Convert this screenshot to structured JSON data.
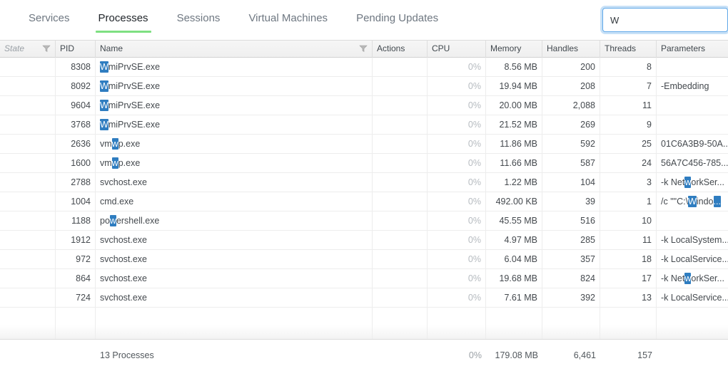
{
  "tabs": [
    {
      "label": "Services",
      "active": false
    },
    {
      "label": "Processes",
      "active": true
    },
    {
      "label": "Sessions",
      "active": false
    },
    {
      "label": "Virtual Machines",
      "active": false
    },
    {
      "label": "Pending Updates",
      "active": false
    }
  ],
  "search": {
    "value": "W",
    "placeholder": ""
  },
  "colors": {
    "active_tab_underline": "#7ee081",
    "search_focus_border": "#5fa8e8",
    "highlight_background": "#2f7dc0",
    "highlight_text": "#ffffff",
    "header_background": "#f2f2f2",
    "inactive_tab_text": "#6e7781",
    "cpu_text": "#b6bbc0"
  },
  "table": {
    "columns": [
      {
        "key": "state",
        "label": "State",
        "align": "left",
        "italic": true,
        "filter_icon": "funnel-icon"
      },
      {
        "key": "pid",
        "label": "PID",
        "align": "right",
        "italic": false,
        "filter_icon": null
      },
      {
        "key": "name",
        "label": "Name",
        "align": "left",
        "italic": false,
        "filter_icon": "funnel-icon"
      },
      {
        "key": "actions",
        "label": "Actions",
        "align": "left",
        "italic": false,
        "filter_icon": null
      },
      {
        "key": "cpu",
        "label": "CPU",
        "align": "right",
        "italic": false,
        "filter_icon": null
      },
      {
        "key": "memory",
        "label": "Memory",
        "align": "right",
        "italic": false,
        "filter_icon": null
      },
      {
        "key": "handles",
        "label": "Handles",
        "align": "right",
        "italic": false,
        "filter_icon": null
      },
      {
        "key": "threads",
        "label": "Threads",
        "align": "right",
        "italic": false,
        "filter_icon": null
      },
      {
        "key": "parameters",
        "label": "Parameters",
        "align": "left",
        "italic": false,
        "filter_icon": null
      }
    ],
    "rows": [
      {
        "state": "",
        "pid": "8308",
        "name": "WmiPrvSE.exe",
        "name_hl": [
          "W"
        ],
        "actions": "",
        "cpu": "0%",
        "memory": "8.56 MB",
        "handles": "200",
        "threads": "8",
        "parameters": "",
        "parameters_hl": []
      },
      {
        "state": "",
        "pid": "8092",
        "name": "WmiPrvSE.exe",
        "name_hl": [
          "W"
        ],
        "actions": "",
        "cpu": "0%",
        "memory": "19.94 MB",
        "handles": "208",
        "threads": "7",
        "parameters": "-Embedding",
        "parameters_hl": []
      },
      {
        "state": "",
        "pid": "9604",
        "name": "WmiPrvSE.exe",
        "name_hl": [
          "W"
        ],
        "actions": "",
        "cpu": "0%",
        "memory": "20.00 MB",
        "handles": "2,088",
        "threads": "11",
        "parameters": "",
        "parameters_hl": []
      },
      {
        "state": "",
        "pid": "3768",
        "name": "WmiPrvSE.exe",
        "name_hl": [
          "W"
        ],
        "actions": "",
        "cpu": "0%",
        "memory": "21.52 MB",
        "handles": "269",
        "threads": "9",
        "parameters": "",
        "parameters_hl": []
      },
      {
        "state": "",
        "pid": "2636",
        "name": "vmwp.exe",
        "name_hl": [
          "w"
        ],
        "actions": "",
        "cpu": "0%",
        "memory": "11.86 MB",
        "handles": "592",
        "threads": "25",
        "parameters": "01C6A3B9-50A...",
        "parameters_hl": []
      },
      {
        "state": "",
        "pid": "1600",
        "name": "vmwp.exe",
        "name_hl": [
          "w"
        ],
        "actions": "",
        "cpu": "0%",
        "memory": "11.66 MB",
        "handles": "587",
        "threads": "24",
        "parameters": "56A7C456-785...",
        "parameters_hl": []
      },
      {
        "state": "",
        "pid": "2788",
        "name": "svchost.exe",
        "name_hl": [],
        "actions": "",
        "cpu": "0%",
        "memory": "1.22 MB",
        "handles": "104",
        "threads": "3",
        "parameters": "-k NetworkSer...",
        "parameters_hl": [
          "w"
        ]
      },
      {
        "state": "",
        "pid": "1004",
        "name": "cmd.exe",
        "name_hl": [],
        "actions": "",
        "cpu": "0%",
        "memory": "492.00 KB",
        "handles": "39",
        "threads": "1",
        "parameters": "/c \"\"C:\\Windo...",
        "parameters_hl": [
          "W",
          "..."
        ]
      },
      {
        "state": "",
        "pid": "1188",
        "name": "powershell.exe",
        "name_hl": [
          "w"
        ],
        "actions": "",
        "cpu": "0%",
        "memory": "45.55 MB",
        "handles": "516",
        "threads": "10",
        "parameters": "",
        "parameters_hl": []
      },
      {
        "state": "",
        "pid": "1912",
        "name": "svchost.exe",
        "name_hl": [],
        "actions": "",
        "cpu": "0%",
        "memory": "4.97 MB",
        "handles": "285",
        "threads": "11",
        "parameters": "-k LocalSystem...",
        "parameters_hl": []
      },
      {
        "state": "",
        "pid": "972",
        "name": "svchost.exe",
        "name_hl": [],
        "actions": "",
        "cpu": "0%",
        "memory": "6.04 MB",
        "handles": "357",
        "threads": "18",
        "parameters": "-k LocalService...",
        "parameters_hl": []
      },
      {
        "state": "",
        "pid": "864",
        "name": "svchost.exe",
        "name_hl": [],
        "actions": "",
        "cpu": "0%",
        "memory": "19.68 MB",
        "handles": "824",
        "threads": "17",
        "parameters": "-k NetworkSer...",
        "parameters_hl": [
          "w"
        ]
      },
      {
        "state": "",
        "pid": "724",
        "name": "svchost.exe",
        "name_hl": [],
        "actions": "",
        "cpu": "0%",
        "memory": "7.61 MB",
        "handles": "392",
        "threads": "13",
        "parameters": "-k LocalService...",
        "parameters_hl": []
      }
    ],
    "summary": {
      "count_label": "13 Processes",
      "cpu": "0%",
      "memory": "179.08 MB",
      "handles": "6,461",
      "threads": "157",
      "parameters": ""
    }
  }
}
